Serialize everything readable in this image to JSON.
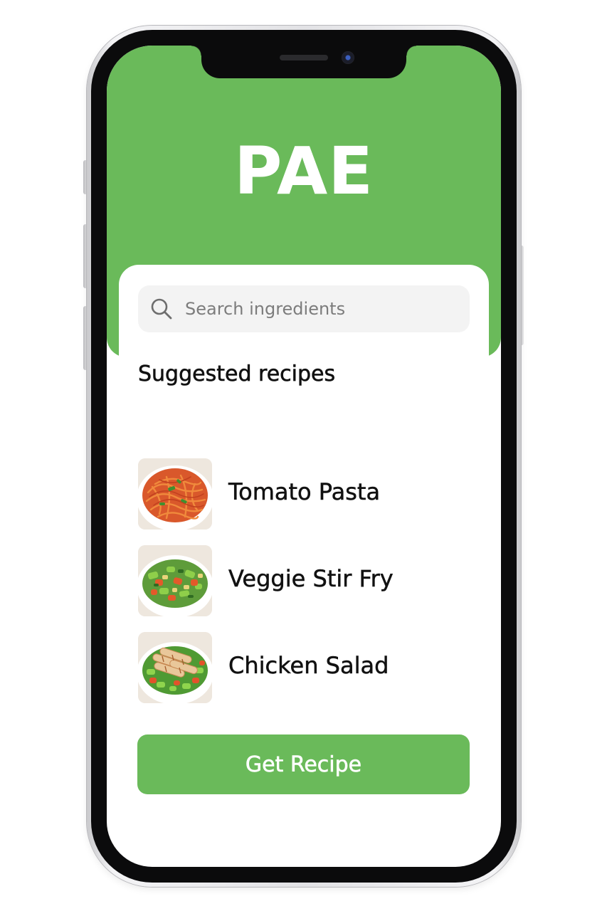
{
  "app": {
    "title": "PAE",
    "brand_color": "#6aba5a"
  },
  "search": {
    "placeholder": "Search ingredients",
    "value": "",
    "icon": "search-icon"
  },
  "suggested": {
    "heading": "Suggested recipes",
    "items": [
      {
        "name": "Tomato Pasta",
        "image": "tomato-pasta-bowl"
      },
      {
        "name": "Veggie Stir Fry",
        "image": "veggie-stir-fry-bowl"
      },
      {
        "name": "Chicken Salad",
        "image": "chicken-salad-bowl"
      }
    ]
  },
  "actions": {
    "get_recipe_label": "Get Recipe"
  }
}
